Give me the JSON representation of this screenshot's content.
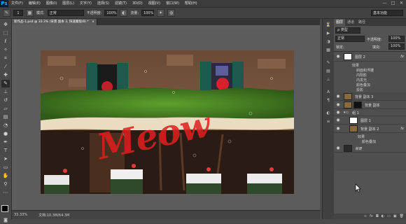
{
  "app": {
    "logo": "Ps"
  },
  "menu": [
    "文件(F)",
    "编辑(E)",
    "图像(I)",
    "图层(L)",
    "文字(Y)",
    "选择(S)",
    "滤镜(T)",
    "3D(D)",
    "视图(V)",
    "窗口(W)",
    "帮助(H)"
  ],
  "window_controls": [
    "—",
    "□",
    "✕"
  ],
  "options": {
    "brush_size": "1",
    "mode_label": "模式:",
    "mode_value": "正常",
    "opacity_label": "不透明度:",
    "opacity_value": "100%",
    "flow_label": "流量:",
    "flow_value": "100%",
    "workspace": "基本功能"
  },
  "doc_tab": {
    "title": "新作品-1.psd @ 33.3% (背景 副本 3, 快速蒙版/8) *",
    "close": "×"
  },
  "status": {
    "zoom": "33.33%",
    "doc": "文档:10.3M/64.3M"
  },
  "panel": {
    "tabs": [
      "图层",
      "通道",
      "路径"
    ],
    "kind_label": "ρ 类型",
    "blend_mode": "正常",
    "opacity_label": "不透明度:",
    "opacity_value": "100%",
    "lock_label": "锁定:",
    "fill_label": "填充:",
    "fill_value": "100%"
  },
  "layers": [
    {
      "name": "图层 2",
      "fx": "fx",
      "effects_label": "效果",
      "effects": [
        "斜面和浮雕",
        "内阴影",
        "内发光",
        "颜色叠加",
        "投影"
      ]
    },
    {
      "name": "背景 副本 3"
    },
    {
      "name": "背景 副本"
    },
    {
      "name": "组 1"
    },
    {
      "name": "图层 1"
    },
    {
      "name": "背景 副本 2",
      "fx": "fx",
      "effects_label": "效果",
      "effects": [
        "颜色叠加"
      ]
    },
    {
      "name": "背景"
    }
  ],
  "canvas_text": "Meow",
  "colors": {
    "accent": "#31a8ff",
    "brush_text": "#e01e1e"
  }
}
